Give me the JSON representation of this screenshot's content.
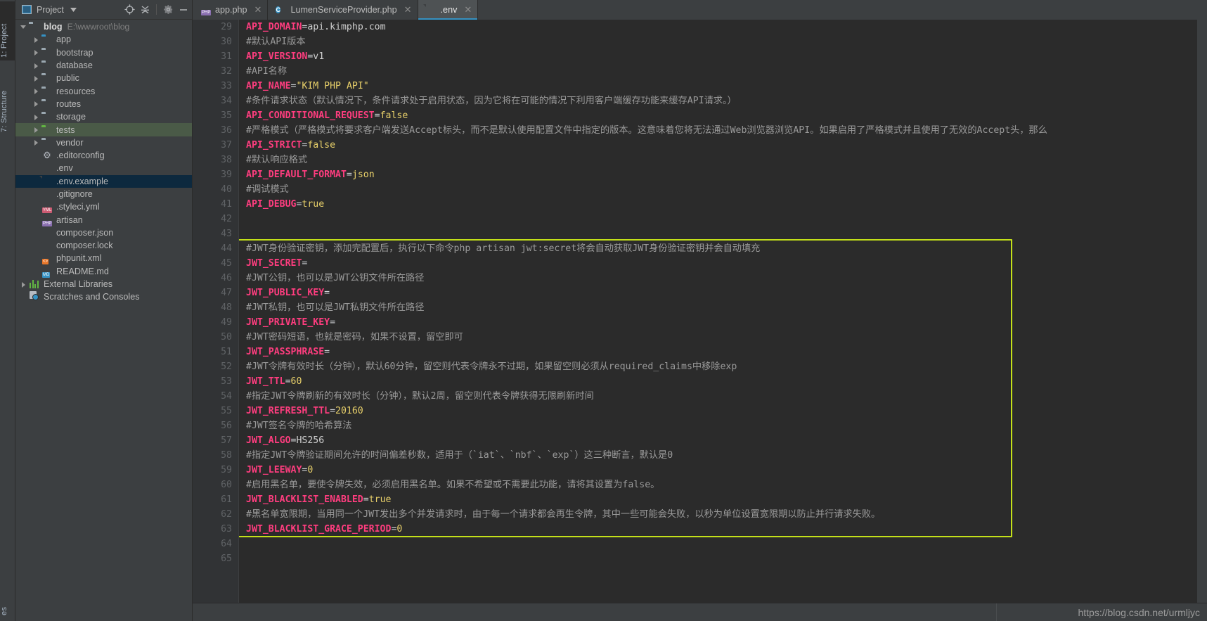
{
  "window": {
    "left_tool_tabs": [
      {
        "label": "1: Project",
        "icon": "project-icon",
        "selected": true
      },
      {
        "label": "7: Structure",
        "icon": "structure-icon",
        "selected": false
      },
      {
        "label": "es",
        "icon": "favorites-icon",
        "selected": false
      }
    ]
  },
  "project_panel": {
    "title": "Project",
    "title_dropdown_icon": "chevron-down-icon",
    "header_icons": [
      "locate-icon",
      "collapse-all-icon",
      "gear-icon",
      "minimize-icon"
    ],
    "tree": [
      {
        "label": "blog",
        "secondary": "E:\\wwwroot\\blog",
        "icon": "folder-gray",
        "arrow": "open",
        "indent": 0,
        "bold": true
      },
      {
        "label": "app",
        "icon": "folder-blue",
        "arrow": "closed",
        "indent": 1
      },
      {
        "label": "bootstrap",
        "icon": "folder-gray",
        "arrow": "closed",
        "indent": 1
      },
      {
        "label": "database",
        "icon": "folder-gray",
        "arrow": "closed",
        "indent": 1
      },
      {
        "label": "public",
        "icon": "folder-gray",
        "arrow": "closed",
        "indent": 1
      },
      {
        "label": "resources",
        "icon": "folder-gray",
        "arrow": "closed",
        "indent": 1
      },
      {
        "label": "routes",
        "icon": "folder-gray",
        "arrow": "closed",
        "indent": 1
      },
      {
        "label": "storage",
        "icon": "folder-gray",
        "arrow": "closed",
        "indent": 1
      },
      {
        "label": "tests",
        "icon": "folder-green",
        "arrow": "closed",
        "indent": 1,
        "state": "hover"
      },
      {
        "label": "vendor",
        "icon": "folder-gray",
        "arrow": "closed",
        "indent": 1
      },
      {
        "label": ".editorconfig",
        "icon": "gear-file-icon",
        "indent": 1
      },
      {
        "label": ".env",
        "icon": "env-file-icon",
        "indent": 1
      },
      {
        "label": ".env.example",
        "icon": "env-file-icon",
        "indent": 1,
        "state": "selected"
      },
      {
        "label": ".gitignore",
        "icon": "ignore-file-icon",
        "indent": 1
      },
      {
        "label": ".styleci.yml",
        "icon": "yml-file-icon",
        "badge": "YML",
        "indent": 1
      },
      {
        "label": "artisan",
        "icon": "php-file-icon",
        "badge": "PHP",
        "indent": 1
      },
      {
        "label": "composer.json",
        "icon": "json-file-icon",
        "indent": 1
      },
      {
        "label": "composer.lock",
        "icon": "lock-file-icon",
        "indent": 1
      },
      {
        "label": "phpunit.xml",
        "icon": "xml-file-icon",
        "badge": "<>",
        "indent": 1
      },
      {
        "label": "README.md",
        "icon": "md-file-icon",
        "badge": "MD",
        "indent": 1
      },
      {
        "label": "External Libraries",
        "icon": "libraries-icon",
        "arrow": "closed",
        "indent": 0
      },
      {
        "label": "Scratches and Consoles",
        "icon": "scratches-icon",
        "indent": 0
      }
    ]
  },
  "editor_tabs": [
    {
      "label": "app.php",
      "icon": "php-file-icon",
      "close_icon": "close-icon",
      "active": false
    },
    {
      "label": "LumenServiceProvider.php",
      "icon": "php-class-icon",
      "close_icon": "close-icon",
      "active": false
    },
    {
      "label": ".env",
      "icon": "env-file-icon",
      "close_icon": "close-icon",
      "active": true
    }
  ],
  "editor": {
    "first_line_number": 29,
    "highlight_color": "#c3e019",
    "highlight_from_line": 44,
    "highlight_to_line": 63,
    "lines": [
      {
        "n": 29,
        "type": "kv",
        "key": "API_DOMAIN",
        "value": "api.kimphp.com",
        "value_kind": "plain"
      },
      {
        "n": 30,
        "type": "comment",
        "text": "#默认API版本"
      },
      {
        "n": 31,
        "type": "kv",
        "key": "API_VERSION",
        "value": "v1",
        "value_kind": "plain"
      },
      {
        "n": 32,
        "type": "comment",
        "text": "#API名称"
      },
      {
        "n": 33,
        "type": "kv",
        "key": "API_NAME",
        "value": "\"KIM PHP API\"",
        "value_kind": "string"
      },
      {
        "n": 34,
        "type": "comment",
        "text": "#条件请求状态（默认情况下，条件请求处于启用状态，因为它将在可能的情况下利用客户端缓存功能来缓存API请求。）"
      },
      {
        "n": 35,
        "type": "kv",
        "key": "API_CONDITIONAL_REQUEST",
        "value": "false",
        "value_kind": "bool"
      },
      {
        "n": 36,
        "type": "comment",
        "text": "#严格模式（严格模式将要求客户端发送Accept标头，而不是默认使用配置文件中指定的版本。这意味着您将无法通过Web浏览器浏览API。如果启用了严格模式并且使用了无效的Accept头，那么"
      },
      {
        "n": 37,
        "type": "kv",
        "key": "API_STRICT",
        "value": "false",
        "value_kind": "bool"
      },
      {
        "n": 38,
        "type": "comment",
        "text": "#默认响应格式"
      },
      {
        "n": 39,
        "type": "kv",
        "key": "API_DEFAULT_FORMAT",
        "value": "json",
        "value_kind": "bool"
      },
      {
        "n": 40,
        "type": "comment",
        "text": "#调试模式"
      },
      {
        "n": 41,
        "type": "kv",
        "key": "API_DEBUG",
        "value": "true",
        "value_kind": "bool"
      },
      {
        "n": 42,
        "type": "blank",
        "text": ""
      },
      {
        "n": 43,
        "type": "blank",
        "text": ""
      },
      {
        "n": 44,
        "type": "comment",
        "text": "#JWT身份验证密钥，添加完配置后，执行以下命令php artisan jwt:secret将会自动获取JWT身份验证密钥并会自动填充"
      },
      {
        "n": 45,
        "type": "kv",
        "key": "JWT_SECRET",
        "value": "",
        "value_kind": "plain"
      },
      {
        "n": 46,
        "type": "comment",
        "text": "#JWT公钥，也可以是JWT公钥文件所在路径"
      },
      {
        "n": 47,
        "type": "kv",
        "key": "JWT_PUBLIC_KEY",
        "value": "",
        "value_kind": "plain"
      },
      {
        "n": 48,
        "type": "comment",
        "text": "#JWT私钥，也可以是JWT私钥文件所在路径"
      },
      {
        "n": 49,
        "type": "kv",
        "key": "JWT_PRIVATE_KEY",
        "value": "",
        "value_kind": "plain"
      },
      {
        "n": 50,
        "type": "comment",
        "text": "#JWT密码短语，也就是密码，如果不设置，留空即可"
      },
      {
        "n": 51,
        "type": "kv",
        "key": "JWT_PASSPHRASE",
        "value": "",
        "value_kind": "plain"
      },
      {
        "n": 52,
        "type": "comment",
        "text": "#JWT令牌有效时长（分钟），默认60分钟，留空则代表令牌永不过期，如果留空则必须从required_claims中移除exp"
      },
      {
        "n": 53,
        "type": "kv",
        "key": "JWT_TTL",
        "value": "60",
        "value_kind": "num"
      },
      {
        "n": 54,
        "type": "comment",
        "text": "#指定JWT令牌刷新的有效时长（分钟），默认2周，留空则代表令牌获得无限刷新时间"
      },
      {
        "n": 55,
        "type": "kv",
        "key": "JWT_REFRESH_TTL",
        "value": "20160",
        "value_kind": "num"
      },
      {
        "n": 56,
        "type": "comment",
        "text": "#JWT签名令牌的哈希算法"
      },
      {
        "n": 57,
        "type": "kv",
        "key": "JWT_ALGO",
        "value": "HS256",
        "value_kind": "plain"
      },
      {
        "n": 58,
        "type": "comment",
        "text": "#指定JWT令牌验证期间允许的时间偏差秒数，适用于（`iat`、`nbf`、`exp`）这三种断言，默认是0"
      },
      {
        "n": 59,
        "type": "kv",
        "key": "JWT_LEEWAY",
        "value": "0",
        "value_kind": "num"
      },
      {
        "n": 60,
        "type": "comment",
        "text": "#启用黑名单，要使令牌失效，必须启用黑名单。如果不希望或不需要此功能，请将其设置为false。"
      },
      {
        "n": 61,
        "type": "kv",
        "key": "JWT_BLACKLIST_ENABLED",
        "value": "true",
        "value_kind": "bool"
      },
      {
        "n": 62,
        "type": "comment",
        "text": "#黑名单宽限期，当用同一个JWT发出多个并发请求时，由于每一个请求都会再生令牌，其中一些可能会失败，以秒为单位设置宽限期以防止并行请求失败。"
      },
      {
        "n": 63,
        "type": "kv",
        "key": "JWT_BLACKLIST_GRACE_PERIOD",
        "value": "0",
        "value_kind": "num"
      },
      {
        "n": 64,
        "type": "blank",
        "text": ""
      },
      {
        "n": 65,
        "type": "blank",
        "text": ""
      }
    ]
  },
  "status_bar": {
    "watermark": "https://blog.csdn.net/urmljyc",
    "left_icon": "terminal-icon"
  }
}
